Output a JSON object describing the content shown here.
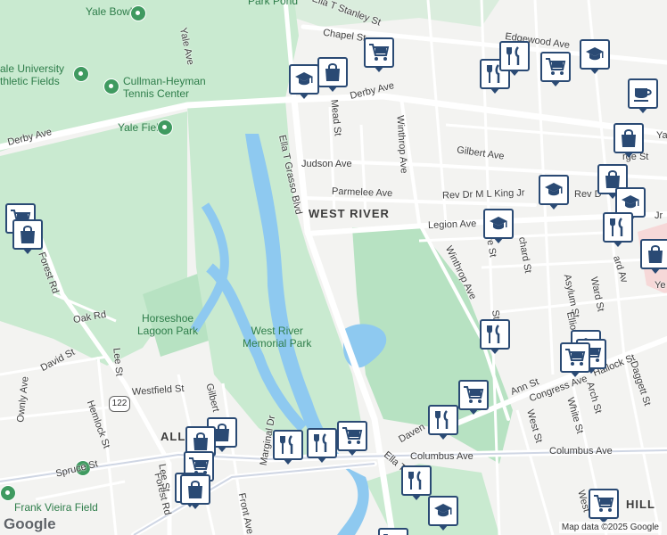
{
  "map": {
    "area_labels": {
      "west_river": "WEST RIVER",
      "hill": "HILL",
      "alli": "ALLI"
    },
    "parks": {
      "yale_bowl": "Yale Bowl",
      "park_pond": "Park Pond",
      "athletic_fields": "ale University\nthletic Fields",
      "tennis": "Cullman-Heyman\nTennis Center",
      "yale_field": "Yale Field",
      "horseshoe": "Horseshoe\nLagoon Park",
      "west_river_park": "West River\nMemorial Park",
      "frank_vieira": "Frank Vieira Field"
    },
    "streets": {
      "yale_ave": "Yale Ave",
      "derby_ave_west": "Derby Ave",
      "derby_ave_east": "Derby Ave",
      "chapel_st": "Chapel St",
      "ella_stanley": "Ella T Stanley St",
      "edgewood_ave": "Edgewood Ave",
      "mead_st": "Mead St",
      "ella_grasso": "Ella T Grasso Blvd",
      "ella_grasso_s": "Ella T Grasso",
      "judson_ave": "Judson Ave",
      "winthrop_ave_n": "Winthrop Ave",
      "gilbert_ave_n": "Gilbert Ave",
      "parmelee_ave": "Parmelee Ave",
      "mlk": "Rev Dr M L King Jr",
      "rev_d": "Rev D",
      "legion_ave": "Legion Ave",
      "winthrop_ave_s": "Winthrop Ave",
      "forest_rd": "Forest Rd",
      "forest_rd_s": "Forest Rd",
      "oak_rd": "Oak Rd",
      "david_st": "David St",
      "lee_st": "Lee St",
      "ownly_ave": "Ownly Ave",
      "westfield_st": "Westfield St",
      "hemlock_st": "Hemlock St",
      "spruce_st": "Spruce St",
      "gilbert_ave_s": "Gilbert",
      "marginal_dr": "Marginal Dr",
      "front_ave": "Front Ave",
      "lee_st_s": "Lee St",
      "columbus_ave": "Columbus Ave",
      "columbus_ave_e": "Columbus Ave",
      "congress_ave": "Congress Ave",
      "davenport": "Daven",
      "ann_st": "Ann St",
      "hallock_st": "Hallock St",
      "daggett_st": "Daggett St",
      "white_st": "White St",
      "arch_st": "Arch St",
      "west_st": "West St",
      "asylum_st": "Asylum St",
      "elliot_st": "Elliot St",
      "ward_st": "Ward St",
      "st_frag": "St",
      "rge_st": "rge St",
      "ve_st": "ve St",
      "chard_st": "chard St",
      "ard_av": "ard Av",
      "jr": "Jr",
      "ye": "Ye",
      "ya": "Ya",
      "ste": "Ste",
      "west_frag": "West",
      "route_122": "122"
    },
    "attribution": "Map data ©2025 Google",
    "logo": "Google"
  },
  "pins": [
    {
      "type": "education",
      "icon": "graduation-cap-icon"
    },
    {
      "type": "shopping",
      "icon": "shopping-bag-icon"
    },
    {
      "type": "grocery",
      "icon": "shopping-cart-icon"
    },
    {
      "type": "restaurant",
      "icon": "fork-knife-icon"
    },
    {
      "type": "cafe",
      "icon": "coffee-cup-icon"
    }
  ],
  "colors": {
    "park_green": "#c9ead0",
    "park_dark": "#b7e2c2",
    "water": "#8ec9f0",
    "road": "#ffffff",
    "road_major": "#cfd6e4",
    "pin_border": "#2a4a74",
    "hospital": "#f6d8d8"
  }
}
